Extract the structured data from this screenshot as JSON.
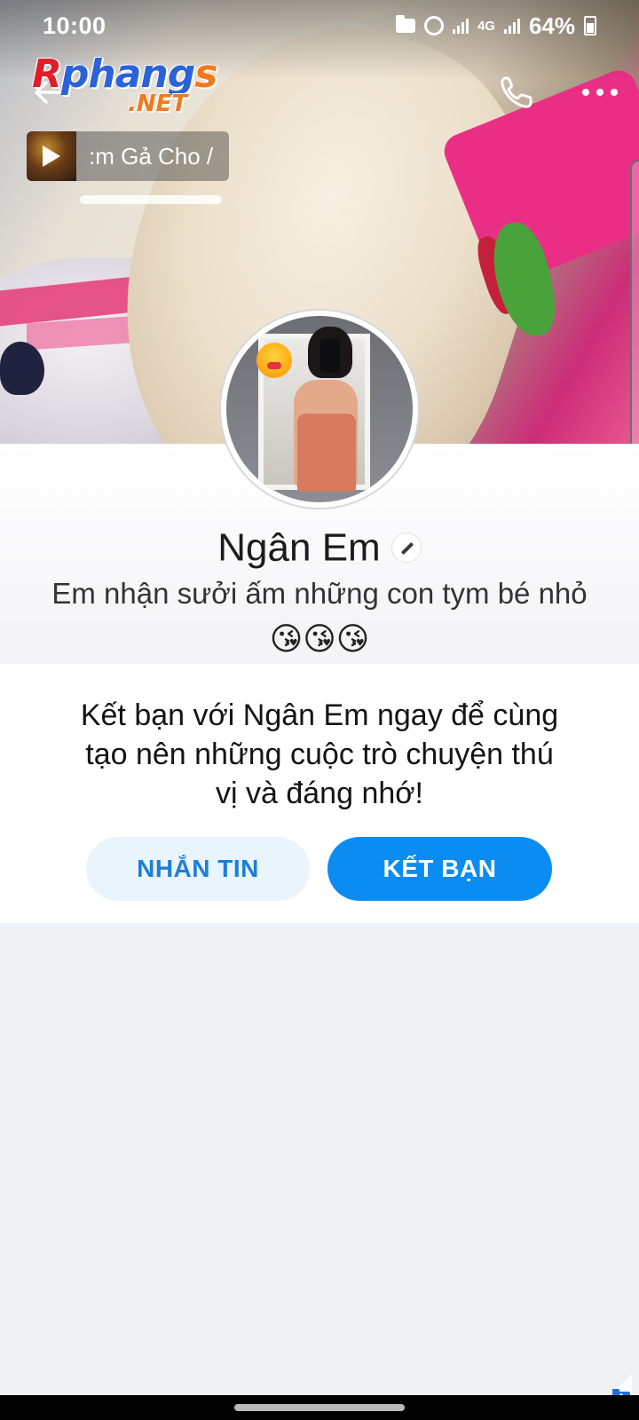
{
  "status_bar": {
    "time": "10:00",
    "network": "4G",
    "battery": "64%"
  },
  "watermark": {
    "line1_r": "R",
    "line1_rest": "phang",
    "line1_s": "s",
    "line2": ".NET"
  },
  "music": {
    "title": ":m Gả Cho /"
  },
  "profile": {
    "name": "Ngân Em",
    "status": "Em nhận sưởi ấm những con tym bé nhỏ",
    "emojis": "😘😘😘"
  },
  "friend_prompt": {
    "text": "Kết bạn với Ngân Em ngay để cùng tạo nên những cuộc trò chuyện thú vị và đáng nhớ!",
    "message_button": "NHẮN TIN",
    "add_friend_button": "KẾT BẠN"
  },
  "icons": {
    "back": "arrow-left-icon",
    "call": "phone-icon",
    "more": "more-horizontal-icon",
    "edit": "pencil-icon",
    "play": "play-icon"
  },
  "colors": {
    "primary_blue": "#0a8cf2",
    "secondary_button_bg": "#e9f4fd",
    "secondary_button_text": "#1d7fd7",
    "page_bg": "#eff0f4"
  }
}
